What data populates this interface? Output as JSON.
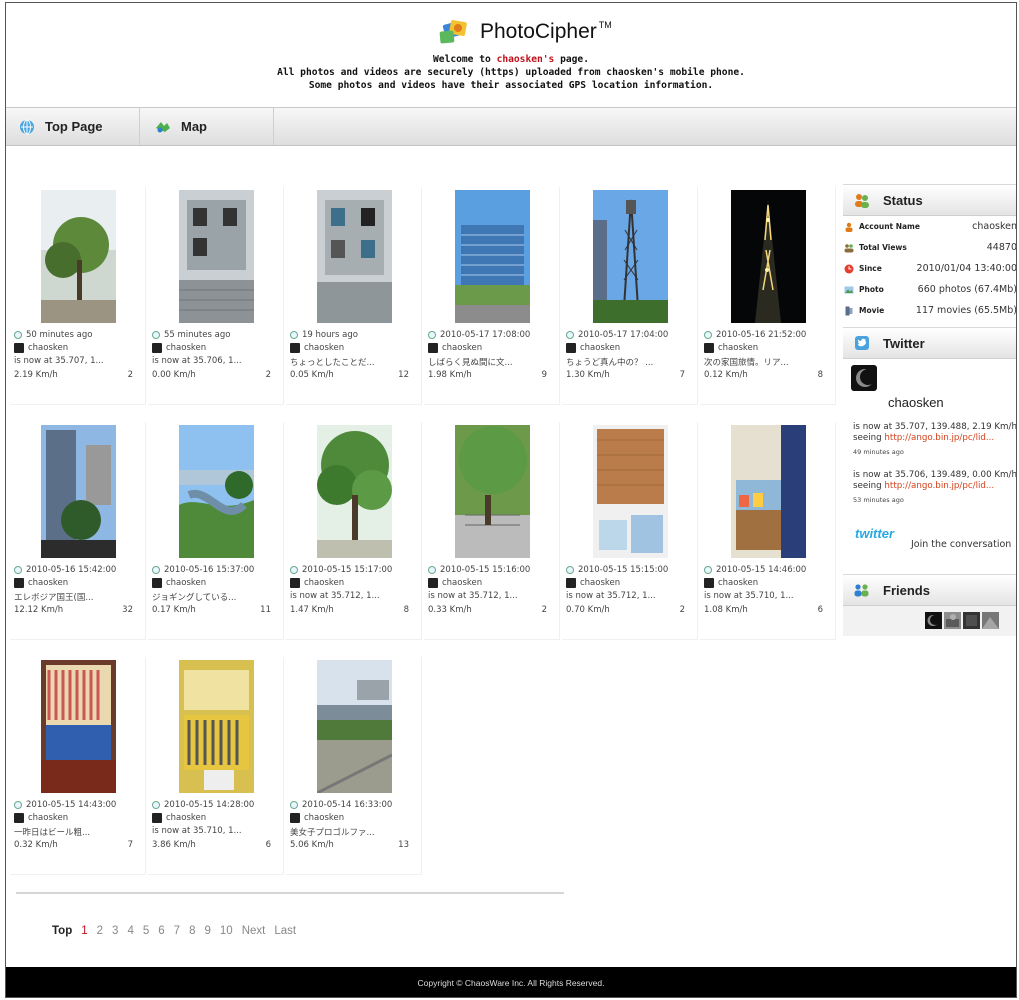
{
  "header": {
    "app_name": "PhotoCipher",
    "tm": "TM",
    "welcome_prefix": "Welcome to ",
    "welcome_user": "chaosken's",
    "welcome_suffix": " page.",
    "line2": "All photos and videos are securely (https) uploaded from chaosken's mobile phone.",
    "line3": "Some photos and videos have their associated GPS location information."
  },
  "nav": {
    "top_page": "Top Page",
    "map": "Map"
  },
  "photos": [
    {
      "time": "50 minutes ago",
      "user": "chaosken",
      "caption": "is now at 35.707, 1...",
      "speed": "2.19 Km/h",
      "count": "2"
    },
    {
      "time": "55 minutes ago",
      "user": "chaosken",
      "caption": "is now at 35.706, 1...",
      "speed": "0.00 Km/h",
      "count": "2"
    },
    {
      "time": "19 hours ago",
      "user": "chaosken",
      "caption": "ちょっとしたことだ...",
      "speed": "0.05 Km/h",
      "count": "12"
    },
    {
      "time": "2010-05-17 17:08:00",
      "user": "chaosken",
      "caption": "しばらく見ぬ間に文...",
      "speed": "1.98 Km/h",
      "count": "9"
    },
    {
      "time": "2010-05-17 17:04:00",
      "user": "chaosken",
      "caption": "ちょうど真ん中の？ ...",
      "speed": "1.30 Km/h",
      "count": "7"
    },
    {
      "time": "2010-05-16 21:52:00",
      "user": "chaosken",
      "caption": "次の家国旅情。リア...",
      "speed": "0.12 Km/h",
      "count": "8"
    },
    {
      "time": "2010-05-16 15:42:00",
      "user": "chaosken",
      "caption": "エレボジア国王(国...",
      "speed": "12.12 Km/h",
      "count": "32"
    },
    {
      "time": "2010-05-16 15:37:00",
      "user": "chaosken",
      "caption": "ジョギングしている...",
      "speed": "0.17 Km/h",
      "count": "11"
    },
    {
      "time": "2010-05-15 15:17:00",
      "user": "chaosken",
      "caption": "is now at 35.712, 1...",
      "speed": "1.47 Km/h",
      "count": "8"
    },
    {
      "time": "2010-05-15 15:16:00",
      "user": "chaosken",
      "caption": "is now at 35.712, 1...",
      "speed": "0.33 Km/h",
      "count": "2"
    },
    {
      "time": "2010-05-15 15:15:00",
      "user": "chaosken",
      "caption": "is now at 35.712, 1...",
      "speed": "0.70 Km/h",
      "count": "2"
    },
    {
      "time": "2010-05-15 14:46:00",
      "user": "chaosken",
      "caption": "is now at 35.710, 1...",
      "speed": "1.08 Km/h",
      "count": "6"
    },
    {
      "time": "2010-05-15 14:43:00",
      "user": "chaosken",
      "caption": "一昨日はビール粗...",
      "speed": "0.32 Km/h",
      "count": "7"
    },
    {
      "time": "2010-05-15 14:28:00",
      "user": "chaosken",
      "caption": "is now at 35.710, 1...",
      "speed": "3.86 Km/h",
      "count": "6"
    },
    {
      "time": "2010-05-14 16:33:00",
      "user": "chaosken",
      "caption": "美女子プロゴルファ...",
      "speed": "5.06 Km/h",
      "count": "13"
    }
  ],
  "pagination": {
    "top": "Top",
    "current": "1",
    "pages": [
      "2",
      "3",
      "4",
      "5",
      "6",
      "7",
      "8",
      "9",
      "10"
    ],
    "next": "Next",
    "last": "Last"
  },
  "sidebar": {
    "status": {
      "title": "Status",
      "rows": [
        {
          "label": "Account Name",
          "value": "chaosken"
        },
        {
          "label": "Total Views",
          "value": "44870"
        },
        {
          "label": "Since",
          "value": "2010/01/04 13:40:00"
        },
        {
          "label": "Photo",
          "value": "660 photos (67.4Mb)"
        },
        {
          "label": "Movie",
          "value": "117 movies (65.5Mb)"
        }
      ]
    },
    "twitter": {
      "title": "Twitter",
      "name": "chaosken",
      "tweets": [
        {
          "text": "is now at 35.707, 139.488, 2.19 Km/h seeing ",
          "link": "http://ango.bin.jp/pc/lid...",
          "ago": "49 minutes ago"
        },
        {
          "text": "is now at 35.706, 139.489, 0.00 Km/h seeing ",
          "link": "http://ango.bin.jp/pc/lid...",
          "ago": "53 minutes ago"
        }
      ],
      "logo": "twitter",
      "join": "Join the conversation"
    },
    "friends": {
      "title": "Friends"
    }
  },
  "footer": {
    "copyright": "Copyright © ChaosWare Inc. All Rights Reserved."
  }
}
